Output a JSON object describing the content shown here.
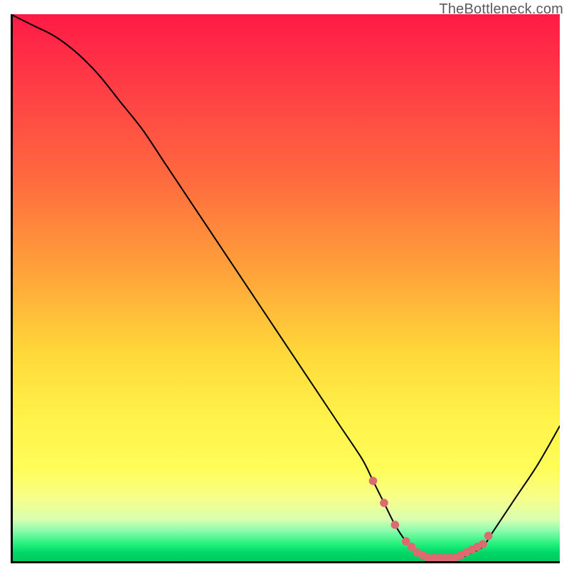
{
  "watermark": "TheBottleneck.com",
  "colors": {
    "curve_stroke": "#000000",
    "marker_fill": "#db6b70",
    "axis_stroke": "#000000"
  },
  "chart_data": {
    "type": "line",
    "title": "",
    "xlabel": "",
    "ylabel": "",
    "xlim": [
      0,
      100
    ],
    "ylim": [
      0,
      100
    ],
    "grid": false,
    "series": [
      {
        "name": "bottleneck-curve",
        "x": [
          0,
          4,
          8,
          12,
          16,
          20,
          24,
          28,
          32,
          36,
          40,
          44,
          48,
          52,
          56,
          60,
          64,
          66,
          68,
          70,
          72,
          74,
          76,
          78,
          80,
          82,
          84,
          86,
          88,
          92,
          96,
          100
        ],
        "y": [
          100,
          98,
          96,
          93,
          89,
          84,
          79,
          73,
          67,
          61,
          55,
          49,
          43,
          37,
          31,
          25,
          19,
          15,
          11,
          7,
          4,
          2,
          1,
          1,
          1,
          1,
          2,
          3,
          6,
          12,
          18,
          25
        ]
      }
    ],
    "highlighted_points": {
      "name": "optimal-range-markers",
      "x": [
        66,
        68,
        70,
        72,
        73,
        74,
        75,
        76,
        77,
        78,
        79,
        80,
        81,
        82,
        83,
        84,
        85,
        86,
        87
      ],
      "y": [
        15,
        11,
        7,
        4,
        3,
        2,
        1.5,
        1,
        1,
        1,
        1,
        1,
        1,
        1.5,
        2,
        2.5,
        3,
        3.5,
        5
      ]
    }
  }
}
